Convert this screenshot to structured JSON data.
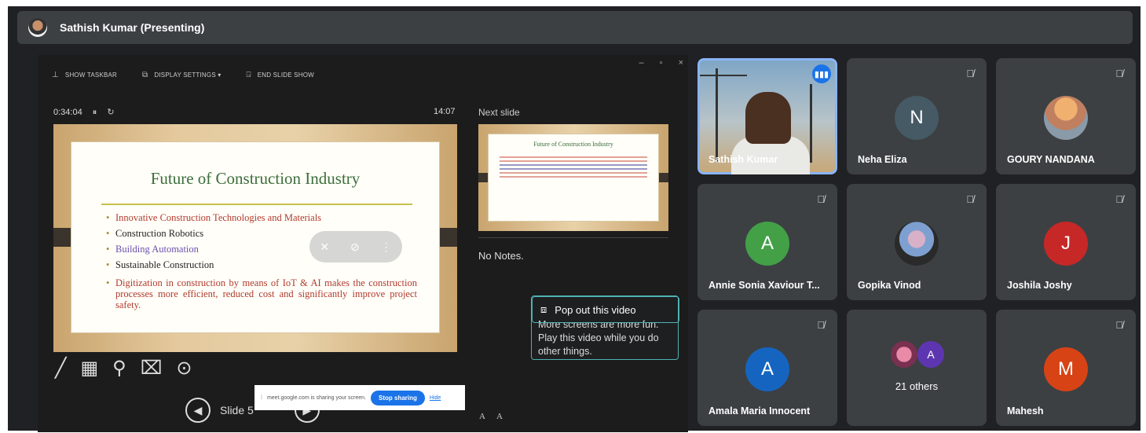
{
  "header": {
    "presenter": "Sathish Kumar (Presenting)"
  },
  "presentation": {
    "toolbar": {
      "show_taskbar": "SHOW TASKBAR",
      "display_settings": "DISPLAY SETTINGS ▾",
      "end_show": "END SLIDE SHOW"
    },
    "window_controls": [
      "–",
      "▫",
      "×"
    ],
    "elapsed": "0:34:04",
    "clock": "14:07",
    "next_slide_label": "Next slide",
    "slide": {
      "title": "Future of Construction Industry",
      "bullets": [
        "Innovative Construction Technologies and Materials",
        "Construction Robotics",
        "Building Automation",
        "Sustainable Construction",
        "Digitization in construction by means of IoT & AI makes the construction processes more efficient, reduced cost and significantly improve project safety."
      ]
    },
    "next_slide_title": "Future of Construction Industry",
    "notes": "No Notes.",
    "slide_counter": "Slide 5",
    "font_buttons": [
      "A",
      "A"
    ]
  },
  "share_banner": {
    "text": "meet.google.com is sharing your screen.",
    "stop": "Stop sharing",
    "hide": "Hide"
  },
  "popout": {
    "title": "Pop out this video",
    "body": "More screens are more fun. Play this video while you do other things."
  },
  "participants": [
    {
      "name": "Sathish Kumar",
      "type": "video",
      "speaking": true
    },
    {
      "name": "Neha Eliza",
      "initial": "N",
      "color": "#455a64"
    },
    {
      "name": "GOURY NANDANA",
      "type": "photo"
    },
    {
      "name": "Annie Sonia Xaviour T...",
      "initial": "A",
      "color": "#43a047"
    },
    {
      "name": "Gopika Vinod",
      "type": "photo"
    },
    {
      "name": "Joshila Joshy",
      "initial": "J",
      "color": "#c62828"
    },
    {
      "name": "Amala Maria Innocent",
      "initial": "A",
      "color": "#1565c0"
    },
    {
      "name": "21 others",
      "type": "group"
    },
    {
      "name": "Mahesh",
      "initial": "M",
      "color": "#d84315"
    }
  ],
  "group_avatar_initial": "A",
  "icons": [
    "mic-off-icon",
    "speaking-icon",
    "pen-icon",
    "search-icon",
    "more-icon",
    "prev-icon",
    "next-icon"
  ]
}
